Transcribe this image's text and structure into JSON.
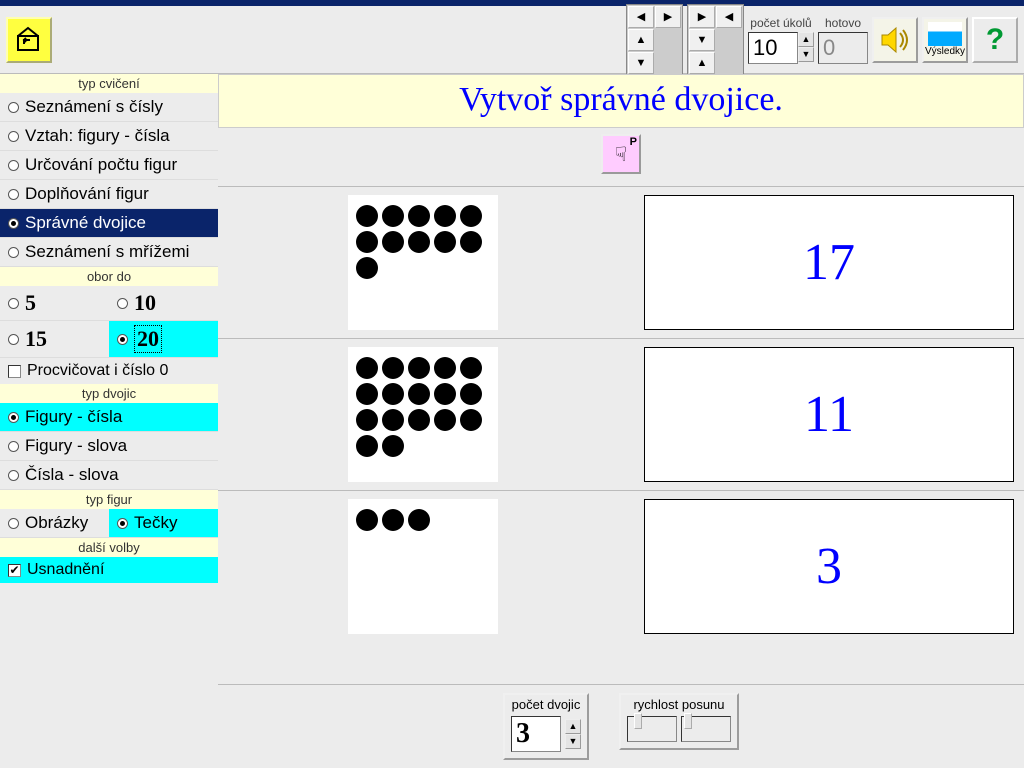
{
  "toolbar": {
    "pocet_ukolu_label": "počet úkolů",
    "pocet_ukolu_value": "10",
    "hotovo_label": "hotovo",
    "hotovo_value": "0",
    "vysledky_label": "Výsledky"
  },
  "sidebar": {
    "typ_cviceni_label": "typ cvičení",
    "cviceni": [
      "Seznámení s čísly",
      "Vztah: figury - čísla",
      "Určování počtu figur",
      "Doplňování figur",
      "Správné dvojice",
      "Seznámení s mřížemi"
    ],
    "obor_do_label": "obor do",
    "obor": [
      "5",
      "10",
      "15",
      "20"
    ],
    "procvicovat_nulu": "Procvičovat i číslo 0",
    "typ_dvojic_label": "typ dvojic",
    "dvojic": [
      "Figury - čísla",
      "Figury - slova",
      "Čísla - slova"
    ],
    "typ_figur_label": "typ figur",
    "figur": [
      "Obrázky",
      "Tečky"
    ],
    "dalsi_volby_label": "další volby",
    "usnadneni": "Usnadnění"
  },
  "main": {
    "instruction": "Vytvoř správné dvojice.",
    "pointer_letter": "P",
    "pairs": [
      {
        "dots": 11,
        "number_card": "17"
      },
      {
        "dots": 17,
        "number_card": "11"
      },
      {
        "dots": 3,
        "number_card": "3"
      }
    ],
    "pocet_dvojic_label": "počet dvojic",
    "pocet_dvojic_value": "3",
    "rychlost_posunu_label": "rychlost posunu"
  }
}
